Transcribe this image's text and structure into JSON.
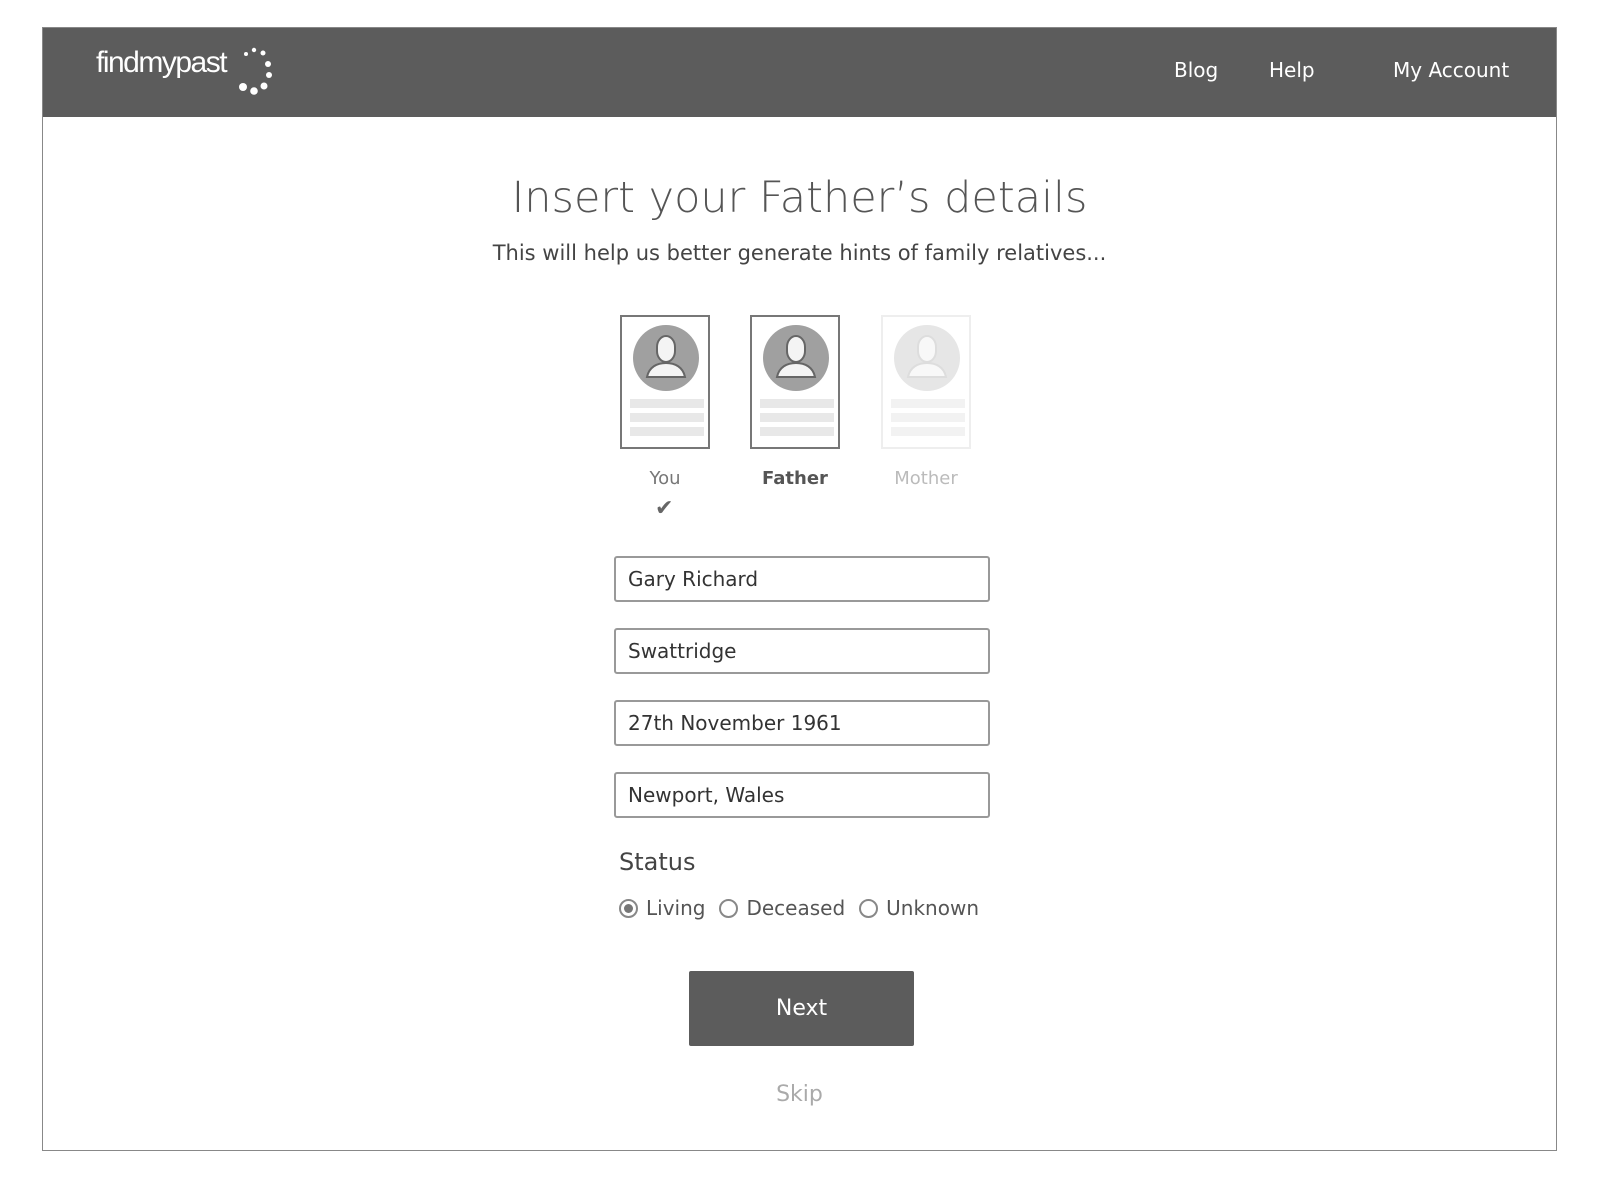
{
  "header": {
    "logo": "findmypast",
    "nav": [
      "Blog",
      "Help",
      "My Account"
    ]
  },
  "main": {
    "title": "Insert your Father’s details",
    "subtitle": "This will help us better generate hints of family relatives...",
    "steps": [
      {
        "label": "You",
        "done": true
      },
      {
        "label": "Father",
        "active": true
      },
      {
        "label": "Mother",
        "active": false
      }
    ],
    "fields": {
      "first_name": "Gary Richard",
      "last_name": "Swattridge",
      "birth_date": "27th November 1961",
      "birth_place": "Newport, Wales"
    },
    "status": {
      "label": "Status",
      "options": [
        "Living",
        "Deceased",
        "Unknown"
      ],
      "selected": "Living"
    },
    "next_label": "Next",
    "skip_label": "Skip"
  }
}
